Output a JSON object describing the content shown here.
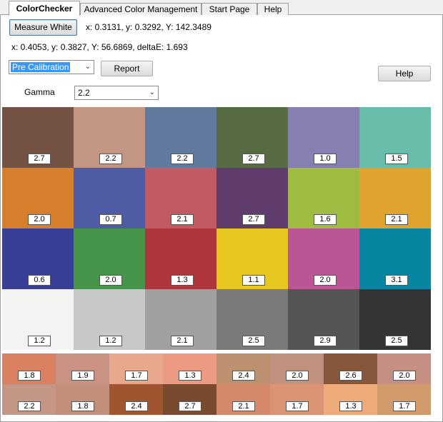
{
  "tabs": [
    {
      "label": "ColorChecker",
      "active": true
    },
    {
      "label": "Advanced Color Management",
      "active": false
    },
    {
      "label": "Start Page",
      "active": false
    },
    {
      "label": "Help",
      "active": false
    }
  ],
  "measure_white_label": "Measure White",
  "white_readout": "x: 0.3131, y: 0.3292, Y: 142.3489",
  "patch_readout": "x: 0.4053, y: 0.3827, Y: 56.6869, deltaE: 1.693",
  "calibration_select": {
    "value": "Pre Calibration"
  },
  "report_label": "Report",
  "help_label": "Help",
  "gamma_label": "Gamma",
  "gamma_select": {
    "value": "2.2"
  },
  "patches": [
    {
      "color": "#735244",
      "value": "2.7"
    },
    {
      "color": "#c29682",
      "value": "2.2"
    },
    {
      "color": "#627a9d",
      "value": "2.2"
    },
    {
      "color": "#576c43",
      "value": "2.7"
    },
    {
      "color": "#8580b1",
      "value": "1.0"
    },
    {
      "color": "#67bdaa",
      "value": "1.5"
    },
    {
      "color": "#d67e2c",
      "value": "2.0"
    },
    {
      "color": "#505ba6",
      "value": "0.7"
    },
    {
      "color": "#c15a63",
      "value": "2.1"
    },
    {
      "color": "#5e3c6c",
      "value": "2.7"
    },
    {
      "color": "#9dbc40",
      "value": "1.6"
    },
    {
      "color": "#e0a32e",
      "value": "2.1"
    },
    {
      "color": "#383d96",
      "value": "0.6"
    },
    {
      "color": "#469449",
      "value": "2.0"
    },
    {
      "color": "#af363c",
      "value": "1.3"
    },
    {
      "color": "#e7c71f",
      "value": "1.1"
    },
    {
      "color": "#bb5695",
      "value": "2.0"
    },
    {
      "color": "#0885a1",
      "value": "3.1"
    },
    {
      "color": "#f3f3f2",
      "value": "1.2"
    },
    {
      "color": "#c8c8c8",
      "value": "1.2"
    },
    {
      "color": "#a0a0a0",
      "value": "2.1"
    },
    {
      "color": "#7a7a79",
      "value": "2.5"
    },
    {
      "color": "#555555",
      "value": "2.9"
    },
    {
      "color": "#343434",
      "value": "2.5"
    }
  ],
  "skin_patches": [
    {
      "color": "#d88060",
      "value": "1.8"
    },
    {
      "color": "#c99282",
      "value": "1.9"
    },
    {
      "color": "#e8a88c",
      "value": "1.7"
    },
    {
      "color": "#ec9a82",
      "value": "1.3"
    },
    {
      "color": "#bd9070",
      "value": "2.4"
    },
    {
      "color": "#c0917c",
      "value": "2.0"
    },
    {
      "color": "#87573c",
      "value": "2.6"
    },
    {
      "color": "#c59083",
      "value": "2.0"
    },
    {
      "color": "#c39686",
      "value": "2.2"
    },
    {
      "color": "#c48f7a",
      "value": "1.8"
    },
    {
      "color": "#a05530",
      "value": "2.4"
    },
    {
      "color": "#7a4a2e",
      "value": "2.7"
    },
    {
      "color": "#d48a6a",
      "value": "2.1"
    },
    {
      "color": "#da9474",
      "value": "1.7"
    },
    {
      "color": "#eeaa78",
      "value": "1.3"
    },
    {
      "color": "#d39a6c",
      "value": "1.7"
    }
  ]
}
